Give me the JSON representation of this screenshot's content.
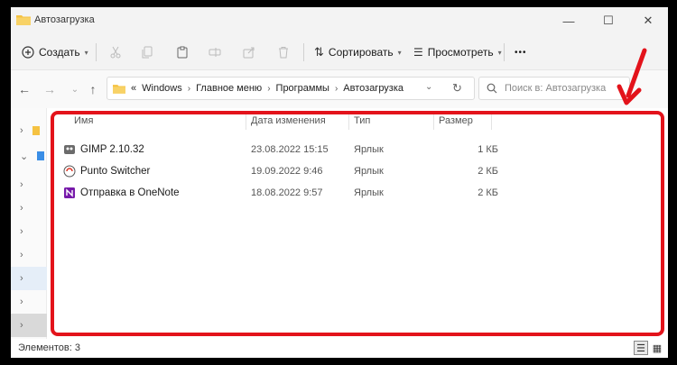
{
  "window": {
    "title": "Автозагрузка",
    "controls": {
      "minimize": "—",
      "maximize": "☐",
      "close": "✕"
    }
  },
  "toolbar": {
    "create_label": "Создать",
    "sort_label": "Сортировать",
    "view_label": "Просмотреть",
    "more_label": "•••"
  },
  "nav": {
    "back": "←",
    "forward": "→",
    "up": "↑",
    "address_prefix": "«",
    "breadcrumbs": [
      "Windows",
      "Главное меню",
      "Программы",
      "Автозагрузка"
    ],
    "search_placeholder": "Поиск в: Автозагрузка"
  },
  "columns": {
    "name": "Имя",
    "date": "Дата изменения",
    "type": "Тип",
    "size": "Размер"
  },
  "files": [
    {
      "name": "GIMP 2.10.32",
      "date": "23.08.2022 15:15",
      "type": "Ярлык",
      "size": "1 КБ",
      "icon": "gimp-icon"
    },
    {
      "name": "Punto Switcher",
      "date": "19.09.2022 9:46",
      "type": "Ярлык",
      "size": "2 КБ",
      "icon": "punto-switcher-icon"
    },
    {
      "name": "Отправка в OneNote",
      "date": "18.08.2022 9:57",
      "type": "Ярлык",
      "size": "2 КБ",
      "icon": "onenote-icon"
    }
  ],
  "status": {
    "item_count": "Элементов: 3"
  },
  "colors": {
    "highlight": "#e3131b",
    "folder": "#f5c242",
    "onenote": "#7719aa"
  }
}
